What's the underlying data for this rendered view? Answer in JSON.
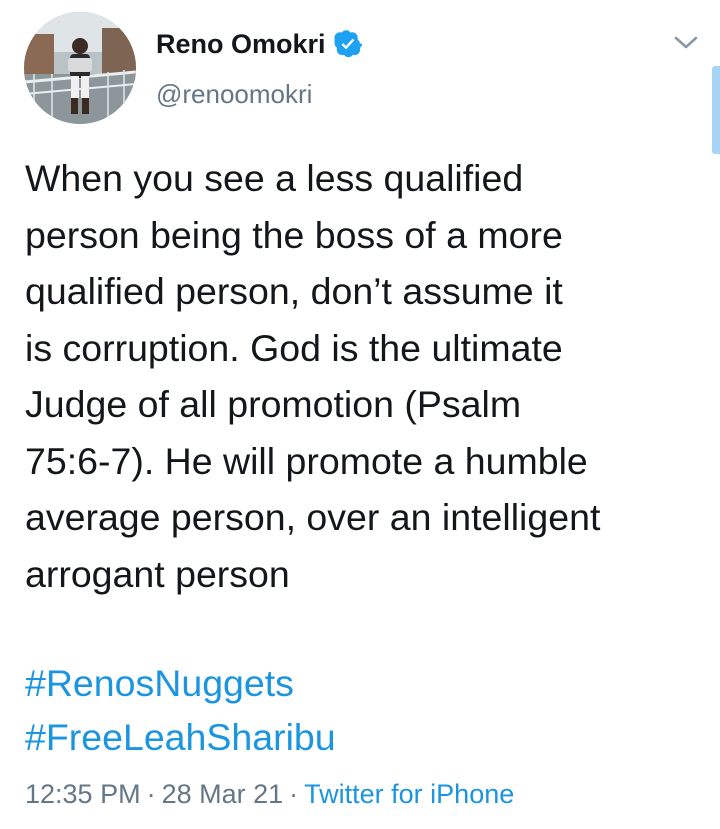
{
  "author": {
    "display_name": "Reno Omokri",
    "handle": "@renoomokri",
    "verified": true
  },
  "tweet": {
    "text_lines": [
      "When you see a less qualified",
      "person being the boss of a more",
      "qualified person, don’t assume it",
      "is corruption. God is the ultimate",
      "Judge of all promotion (Psalm",
      "75:6-7). He will promote a humble",
      "average person, over an intelligent",
      "arrogant person"
    ],
    "hashtags": [
      "#RenosNuggets",
      "#FreeLeahSharibu"
    ],
    "time": "12:35 PM",
    "separator": "·",
    "date": "28 Mar 21",
    "source": "Twitter for iPhone"
  },
  "icons": {
    "verified_badge": "verified-badge-icon",
    "menu": "chevron-down-icon"
  },
  "colors": {
    "link": "#1b95e0",
    "secondary_text": "#657786",
    "primary_text": "#14171a",
    "verified": "#1da1f2"
  }
}
